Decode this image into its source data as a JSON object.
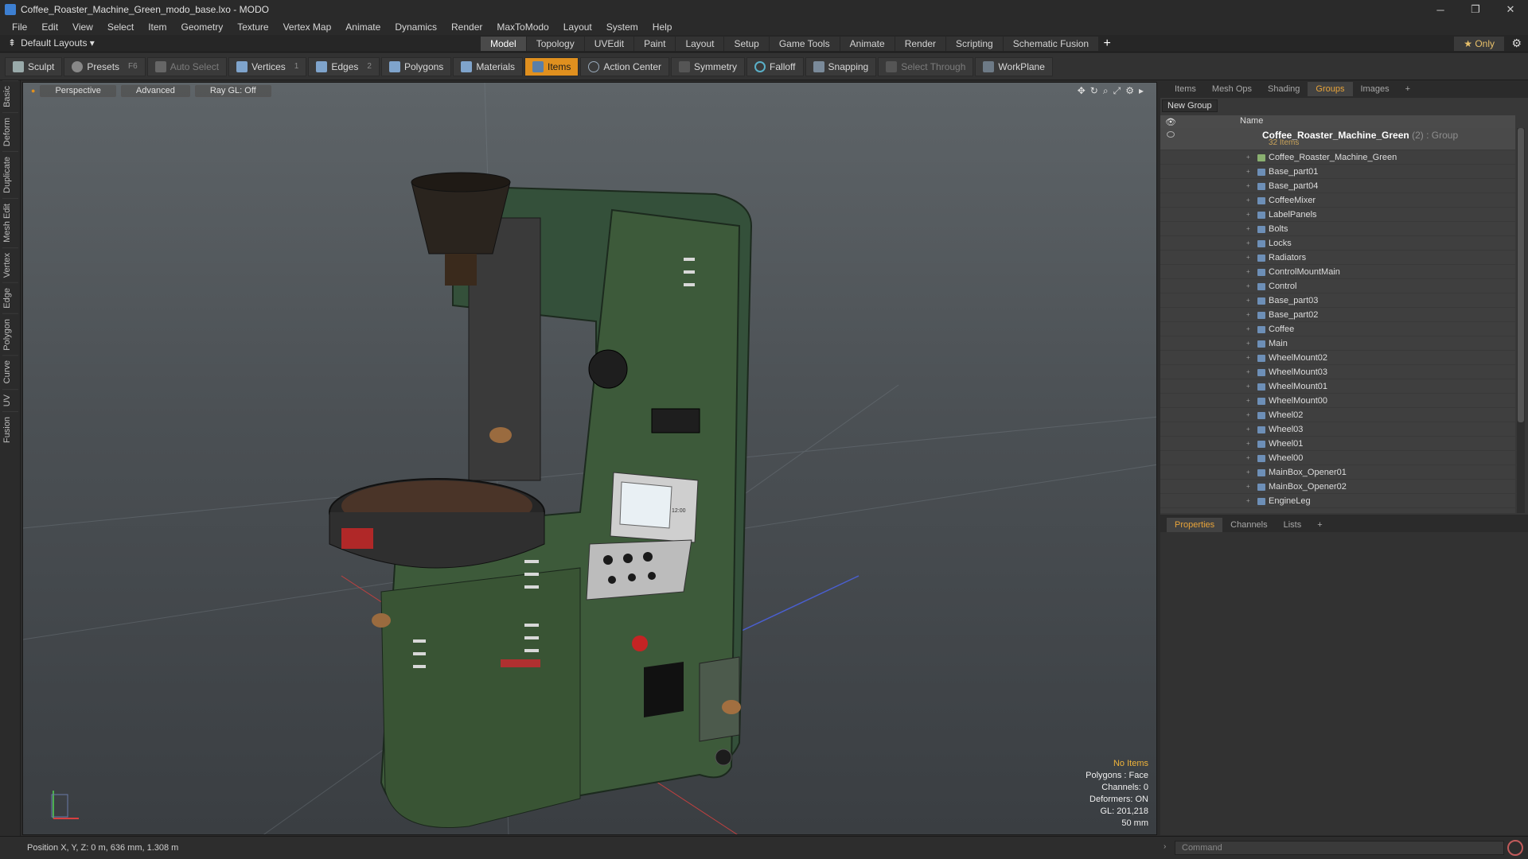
{
  "window": {
    "title": "Coffee_Roaster_Machine_Green_modo_base.lxo - MODO",
    "minimize": "─",
    "maximize": "❐",
    "close": "✕"
  },
  "menu": [
    "File",
    "Edit",
    "View",
    "Select",
    "Item",
    "Geometry",
    "Texture",
    "Vertex Map",
    "Animate",
    "Dynamics",
    "Render",
    "MaxToModo",
    "Layout",
    "System",
    "Help"
  ],
  "layoutbar": {
    "layout_name": "Default Layouts ▾",
    "tabs": [
      "Model",
      "Topology",
      "UVEdit",
      "Paint",
      "Layout",
      "Setup",
      "Game Tools",
      "Animate",
      "Render",
      "Scripting",
      "Schematic Fusion"
    ],
    "active_tab": "Model",
    "plus": "+",
    "only_label": "★  Only",
    "gear": "⚙"
  },
  "toolbar": {
    "sculpt": "Sculpt",
    "presets": "Presets",
    "presets_hotkey": "F6",
    "auto_select": "Auto Select",
    "vertices": "Vertices",
    "vertices_count": "1",
    "edges": "Edges",
    "edges_count": "2",
    "polygons": "Polygons",
    "materials": "Materials",
    "items": "Items",
    "action_center": "Action Center",
    "symmetry": "Symmetry",
    "falloff": "Falloff",
    "snapping": "Snapping",
    "select_through": "Select Through",
    "workplane": "WorkPlane"
  },
  "left_tabs": [
    "Basic",
    "Deform",
    "Duplicate",
    "Mesh Edit",
    "Vertex",
    "Edge",
    "Polygon",
    "Curve",
    "UV",
    "Fusion"
  ],
  "viewport": {
    "perspective": "Perspective",
    "advanced": "Advanced",
    "raygl": "Ray GL: Off",
    "info": {
      "no_items": "No Items",
      "polygons": "Polygons : Face",
      "channels": "Channels: 0",
      "deformers": "Deformers: ON",
      "gl": "GL: 201,218",
      "scale": "50 mm"
    },
    "screen_label": "12:00"
  },
  "status": {
    "position": "Position X, Y, Z:  0 m, 636 mm, 1.308 m",
    "command_placeholder": "Command",
    "arrow": "›"
  },
  "right_panel": {
    "tabs": [
      "Items",
      "Mesh Ops",
      "Shading",
      "Groups",
      "Images",
      "+"
    ],
    "active_tab": "Groups",
    "new_group": "New Group",
    "name_header": "Name",
    "group": {
      "name": "Coffee_Roaster_Machine_Green",
      "count": "(2)",
      "type": ": Group",
      "items": "32 Items"
    },
    "items": [
      "Coffee_Roaster_Machine_Green",
      "Base_part01",
      "Base_part04",
      "CoffeeMixer",
      "LabelPanels",
      "Bolts",
      "Locks",
      "Radiators",
      "ControlMountMain",
      "Control",
      "Base_part03",
      "Base_part02",
      "Coffee",
      "Main",
      "WheelMount02",
      "WheelMount03",
      "WheelMount01",
      "WheelMount00",
      "Wheel02",
      "Wheel03",
      "Wheel01",
      "Wheel00",
      "MainBox_Opener01",
      "MainBox_Opener02",
      "EngineLeg"
    ],
    "props_tabs": [
      "Properties",
      "Channels",
      "Lists",
      "+"
    ],
    "props_active": "Properties"
  },
  "colors": {
    "accent": "#e0901f",
    "machine_green": "#3d5a3a",
    "viewport_top": "#5e6468"
  }
}
